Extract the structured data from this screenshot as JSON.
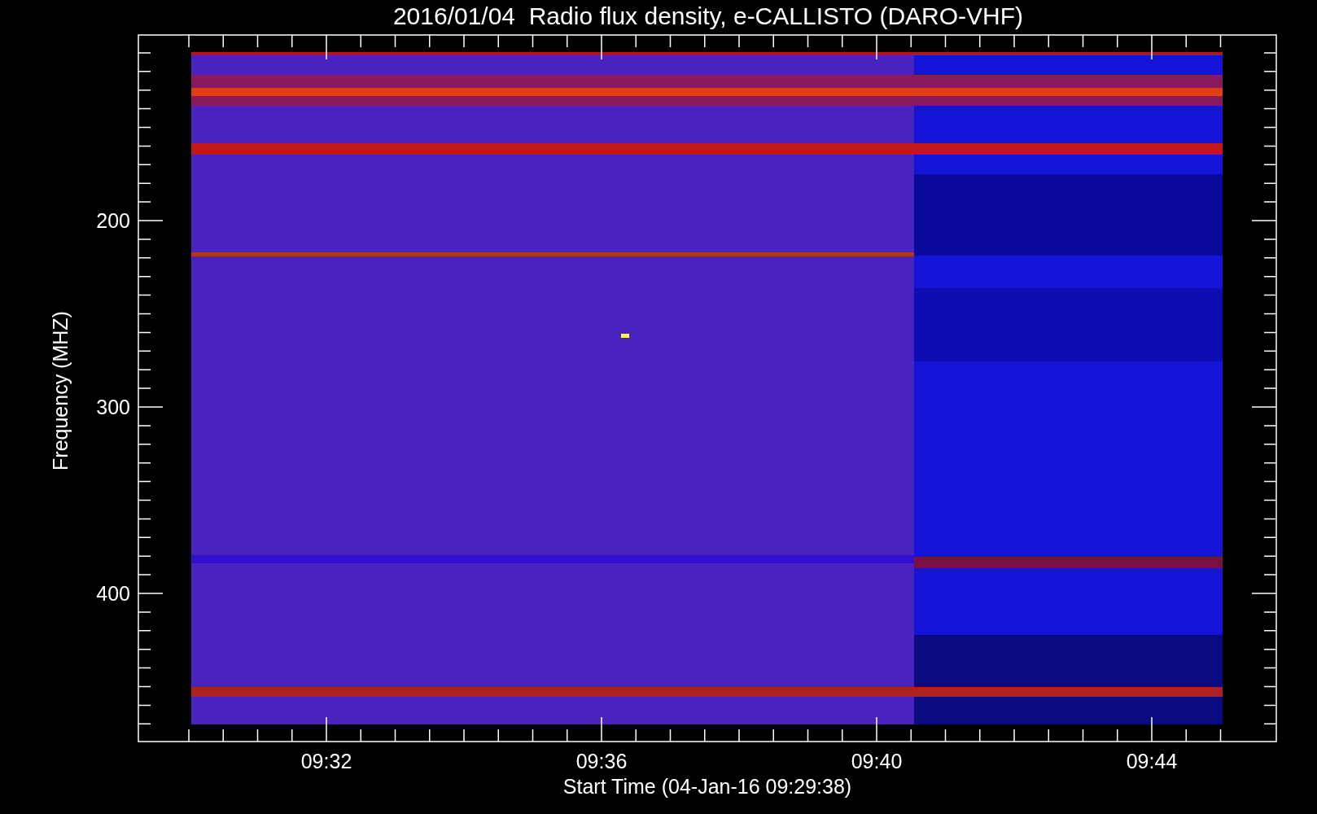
{
  "title": "2016/01/04  Radio flux density, e-CALLISTO (DARO-VHF)",
  "y_axis": {
    "label": "Frequency (MHZ)",
    "ticks": [
      "200",
      "300",
      "400"
    ]
  },
  "x_axis": {
    "label": "Start Time (04-Jan-16 09:29:38)",
    "ticks": [
      "09:32",
      "09:36",
      "09:40",
      "09:44"
    ]
  }
}
